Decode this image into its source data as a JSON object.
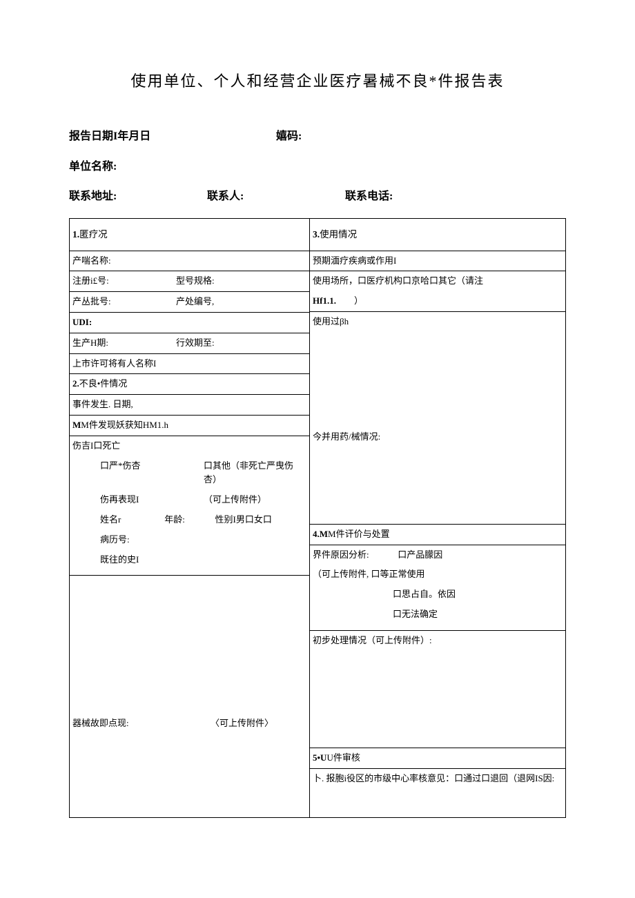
{
  "title": "使用单位、个人和经营企业医疗暑械不良*件报告表",
  "header": {
    "reportDate": "报告日期I年月日",
    "code": "嬉码:",
    "unitName": "单位名称:",
    "address": "联系地址:",
    "contactPerson": "联系人:",
    "phone": "联系电话:"
  },
  "s1": {
    "heading": "匿疗况",
    "productName": "产喘名称:",
    "regNo": "注册i£号:",
    "model": "型号规格:",
    "batchNo": "产丛批号:",
    "prodNo": "产处编号,",
    "udi": "UDI:",
    "prodDate": "生产H期:",
    "expiry": "行效期至:",
    "holder": "上市许可将有人名称I"
  },
  "s2": {
    "heading": "不良•件情况",
    "eventDate": "事件发生. 日期,",
    "found": "M件发现妖获知HM1.h",
    "injuryDeath": "伤吉I口死亡",
    "severe": "口严*伤杏",
    "other": "口其他（非死亡严曳伤杏）",
    "manifest": "伤再表现I",
    "attach1": "（可上传附件）",
    "name": "姓名r",
    "age": "年龄:",
    "gender": "性别I男口女口",
    "caseNo": "病历号:",
    "history": "既往的史I",
    "malfunction": "器械故即点现:",
    "attach2": "〈可上传附件〉"
  },
  "s3": {
    "heading": "使用情况",
    "intended": "预期湎疗疾病或作用I",
    "location": "使用场所，口医疗机构口京哈口其它（请注",
    "hf": "Hf1.1.",
    "paren": "）",
    "process": "使用过βh",
    "combined": "今并用药/械情况:"
  },
  "s4": {
    "heading": "M件讦价与处置",
    "analysis": "界件原因分析:",
    "cause1": "口产品朦因",
    "attach3": "（可上传附件,",
    "cause2": "口等正常使用",
    "cause3": "口思占自。依因",
    "cause4": "口无法确定",
    "initial": "初步处理情况（可上传附件）:"
  },
  "s5": {
    "heading": "U件审核",
    "review": "卜. 报胞i役区的市级中心率核意见：口通过口退回（退网IS因:"
  }
}
